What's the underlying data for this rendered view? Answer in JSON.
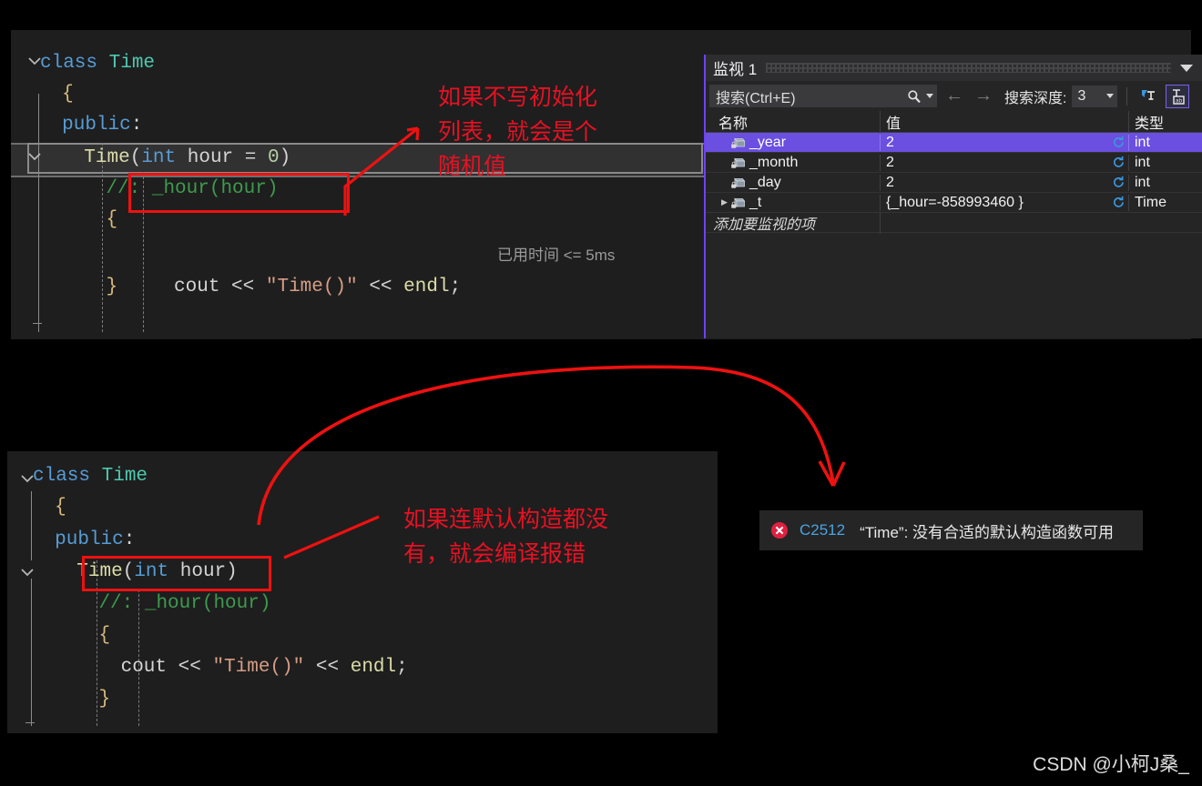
{
  "editor_top": {
    "name": "code-editor-top",
    "lines": [
      {
        "indent": 0,
        "tokens": [
          {
            "t": "class",
            "c": "kw"
          },
          {
            "t": " ",
            "c": "pl"
          },
          {
            "t": "Time",
            "c": "type"
          }
        ]
      },
      {
        "indent": 1,
        "tokens": [
          {
            "t": "{",
            "c": "brace"
          }
        ]
      },
      {
        "indent": 1,
        "tokens": [
          {
            "t": "public",
            "c": "kw"
          },
          {
            "t": ":",
            "c": "pl"
          }
        ]
      },
      {
        "indent": 2,
        "tokens": [
          {
            "t": "Time",
            "c": "fn"
          },
          {
            "t": "(",
            "c": "pl"
          },
          {
            "t": "int",
            "c": "kw"
          },
          {
            "t": " hour ",
            "c": "pl"
          },
          {
            "t": "=",
            "c": "pl"
          },
          {
            "t": " ",
            "c": "pl"
          },
          {
            "t": "0",
            "c": "num"
          },
          {
            "t": ")",
            "c": "pl"
          }
        ]
      },
      {
        "indent": 3,
        "tokens": [
          {
            "t": "//: _hour(hour)",
            "c": "cmt"
          }
        ]
      },
      {
        "indent": 3,
        "tokens": [
          {
            "t": "{",
            "c": "brace"
          }
        ]
      },
      {
        "indent": 4,
        "tokens": [
          {
            "t": "cout",
            "c": "pl"
          },
          {
            "t": " ",
            "c": "pl"
          },
          {
            "t": "<<",
            "c": "op"
          },
          {
            "t": " ",
            "c": "pl"
          },
          {
            "t": "\"Time()\"",
            "c": "str"
          },
          {
            "t": " ",
            "c": "pl"
          },
          {
            "t": "<<",
            "c": "op"
          },
          {
            "t": " ",
            "c": "pl"
          },
          {
            "t": "endl",
            "c": "fn"
          },
          {
            "t": ";",
            "c": "pl"
          }
        ]
      },
      {
        "indent": 3,
        "tokens": [
          {
            "t": "}",
            "c": "brace"
          }
        ]
      }
    ],
    "elapsed_hint": "已用时间 <= 5ms",
    "exec_line_index": 3
  },
  "editor_bottom": {
    "name": "code-editor-bottom",
    "lines": [
      {
        "indent": 0,
        "tokens": [
          {
            "t": "class",
            "c": "kw"
          },
          {
            "t": " ",
            "c": "pl"
          },
          {
            "t": "Time",
            "c": "type"
          }
        ]
      },
      {
        "indent": 1,
        "tokens": [
          {
            "t": "{",
            "c": "brace"
          }
        ]
      },
      {
        "indent": 1,
        "tokens": [
          {
            "t": "public",
            "c": "kw"
          },
          {
            "t": ":",
            "c": "pl"
          }
        ]
      },
      {
        "indent": 2,
        "tokens": [
          {
            "t": "Time",
            "c": "fn"
          },
          {
            "t": "(",
            "c": "pl"
          },
          {
            "t": "int",
            "c": "kw"
          },
          {
            "t": " hour",
            "c": "pl"
          },
          {
            "t": ")",
            "c": "pl"
          }
        ]
      },
      {
        "indent": 3,
        "tokens": [
          {
            "t": "//: _hour(hour)",
            "c": "cmt"
          }
        ]
      },
      {
        "indent": 3,
        "tokens": [
          {
            "t": "{",
            "c": "brace"
          }
        ]
      },
      {
        "indent": 4,
        "tokens": [
          {
            "t": "cout",
            "c": "pl"
          },
          {
            "t": " ",
            "c": "pl"
          },
          {
            "t": "<<",
            "c": "op"
          },
          {
            "t": " ",
            "c": "pl"
          },
          {
            "t": "\"Time()\"",
            "c": "str"
          },
          {
            "t": " ",
            "c": "pl"
          },
          {
            "t": "<<",
            "c": "op"
          },
          {
            "t": " ",
            "c": "pl"
          },
          {
            "t": "endl",
            "c": "fn"
          },
          {
            "t": ";",
            "c": "pl"
          }
        ]
      },
      {
        "indent": 3,
        "tokens": [
          {
            "t": "}",
            "c": "brace"
          }
        ]
      }
    ]
  },
  "annotations": {
    "top_note": "如果不写初始化\n列表，就会是个\n随机值",
    "bottom_note": "如果连默认构造都没\n有，就会编译报错",
    "highlight_color": "#ee1111"
  },
  "watch": {
    "title": "监视 1",
    "search": {
      "placeholder": "搜索(Ctrl+E)"
    },
    "depth_label": "搜索深度:",
    "depth_value": "3",
    "columns": [
      "名称",
      "值",
      "类型"
    ],
    "rows": [
      {
        "name": "_year",
        "value": "2",
        "type": "int",
        "selected": true,
        "expandable": false
      },
      {
        "name": "_month",
        "value": "2",
        "type": "int",
        "selected": false,
        "expandable": false
      },
      {
        "name": "_day",
        "value": "2",
        "type": "int",
        "selected": false,
        "expandable": false
      },
      {
        "name": "_t",
        "value": "{_hour=-858993460 }",
        "type": "Time",
        "selected": false,
        "expandable": true
      }
    ],
    "add_row_text": "添加要监视的项",
    "selection_color": "#6b4fe0",
    "accent_border": "#6f42f5"
  },
  "error_item": {
    "code": "C2512",
    "message": "“Time”: 没有合适的默认构造函数可用",
    "severity": "error",
    "icon_color": "#e02040"
  },
  "watermark": {
    "text": "CSDN @小柯J桑_"
  }
}
